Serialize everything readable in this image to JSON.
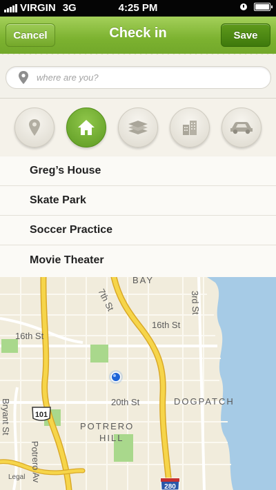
{
  "status_bar": {
    "carrier": "VIRGIN",
    "network": "3G",
    "time": "4:25 PM"
  },
  "nav": {
    "cancel_label": "Cancel",
    "title": "Check in",
    "save_label": "Save"
  },
  "search": {
    "placeholder": "where are you?",
    "value": ""
  },
  "categories": [
    {
      "icon": "location-pin-icon",
      "selected": false
    },
    {
      "icon": "home-icon",
      "selected": true
    },
    {
      "icon": "books-icon",
      "selected": false
    },
    {
      "icon": "building-icon",
      "selected": false
    },
    {
      "icon": "car-icon",
      "selected": false
    }
  ],
  "places": [
    {
      "label": "Greg’s House"
    },
    {
      "label": "Skate Park"
    },
    {
      "label": "Soccer Practice"
    },
    {
      "label": "Movie Theater"
    }
  ],
  "map": {
    "labels": [
      "BAY",
      "7th St",
      "3rd St",
      "16th St",
      "16th St",
      "DOGPATCH",
      "20th St",
      "POTRERO",
      "HILL",
      "Bryant St",
      "Potrero Av",
      "Legal"
    ],
    "shields": [
      "101",
      "280"
    ]
  },
  "colors": {
    "accent_green": "#7cb230",
    "save_green": "#4a8614",
    "water": "#a6cbe6",
    "park": "#a9d88c",
    "highway": "#f6d54a"
  }
}
